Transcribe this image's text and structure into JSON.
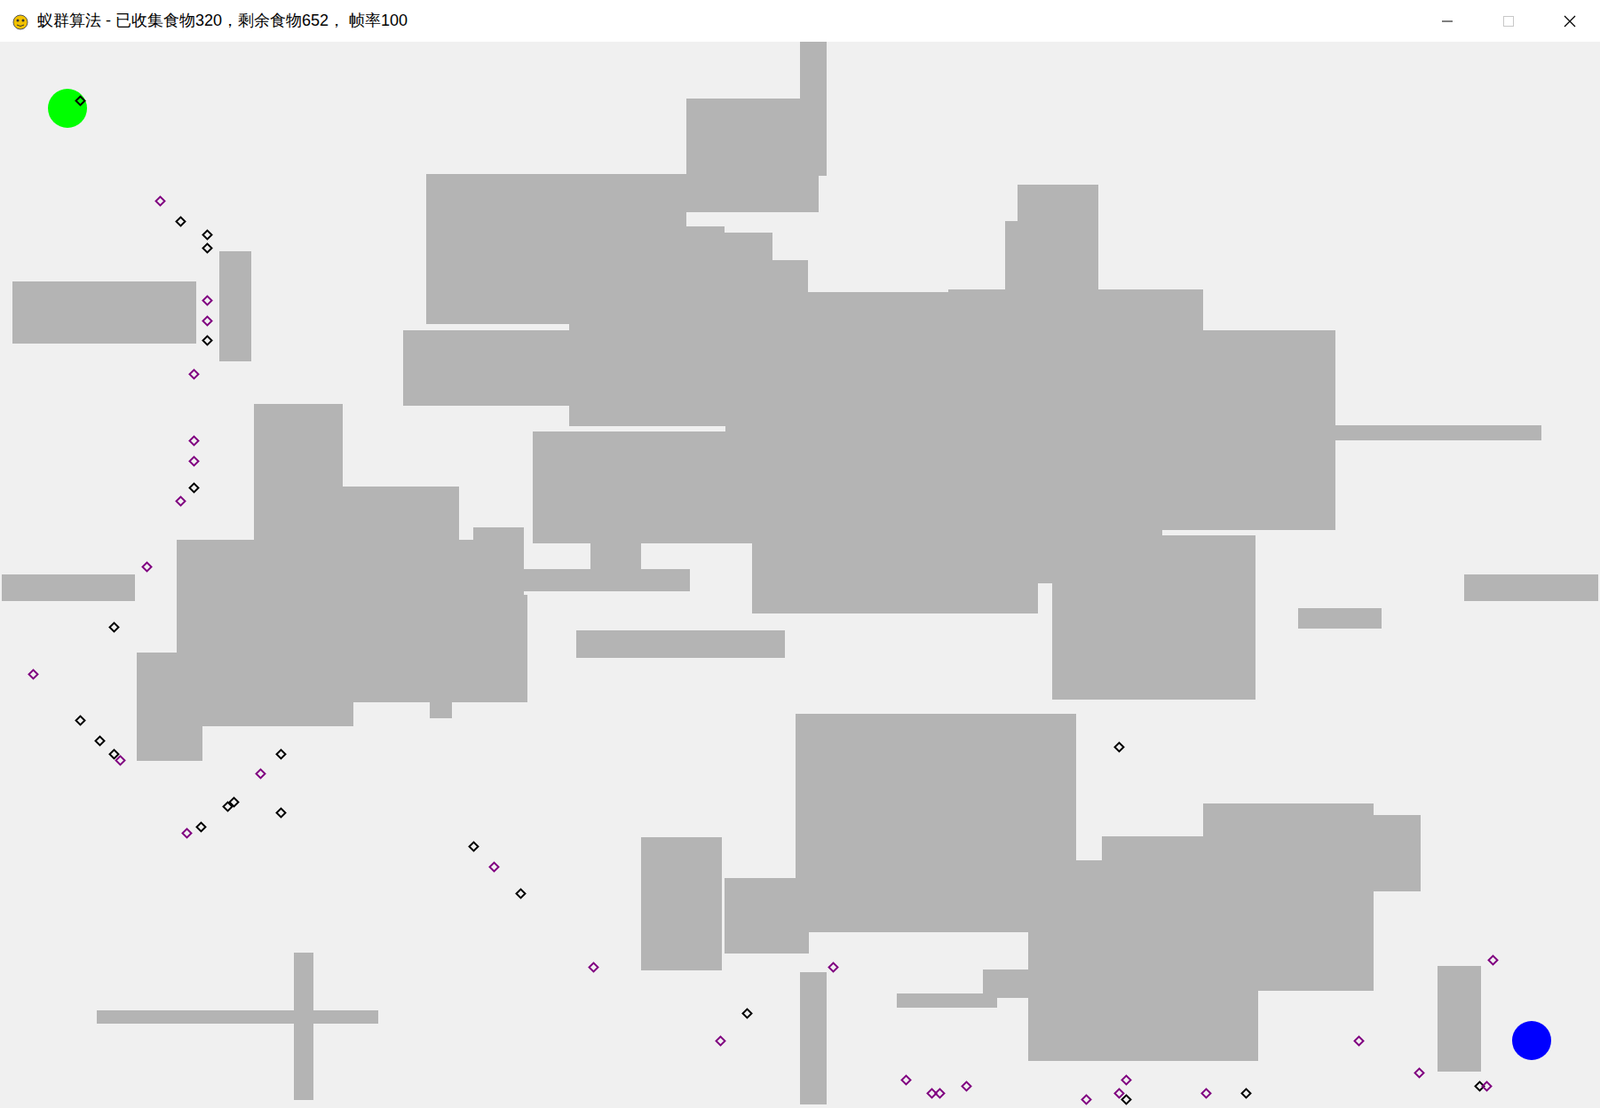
{
  "window": {
    "title": "蚁群算法 - 已收集食物320，剩余食物652， 帧率100",
    "controls": [
      {
        "kind": "minimize",
        "disabled": false
      },
      {
        "kind": "maximize",
        "disabled": true
      },
      {
        "kind": "close",
        "disabled": false
      }
    ]
  },
  "map": {
    "nest": {
      "color": "#00ff00"
    },
    "food_source": {
      "color": "#0000ff"
    },
    "ants": [
      {
        "color": "#000000"
      },
      {
        "color": "#800080"
      },
      {
        "color": "#000000"
      },
      {
        "color": "#000000"
      },
      {
        "color": "#000000"
      },
      {
        "color": "#800080"
      },
      {
        "color": "#800080"
      },
      {
        "color": "#000000"
      },
      {
        "color": "#800080"
      },
      {
        "color": "#800080"
      },
      {
        "color": "#800080"
      },
      {
        "color": "#000000"
      },
      {
        "color": "#800080"
      },
      {
        "color": "#800080"
      },
      {
        "color": "#000000"
      },
      {
        "color": "#800080"
      },
      {
        "color": "#000000"
      },
      {
        "color": "#000000"
      },
      {
        "color": "#000000"
      },
      {
        "color": "#800080"
      },
      {
        "color": "#000000"
      },
      {
        "color": "#800080"
      },
      {
        "color": "#000000"
      },
      {
        "color": "#000000"
      },
      {
        "color": "#000000"
      },
      {
        "color": "#800080"
      },
      {
        "color": "#000000"
      },
      {
        "color": "#000000"
      },
      {
        "color": "#800080"
      },
      {
        "color": "#000000"
      },
      {
        "color": "#800080"
      },
      {
        "color": "#800080"
      },
      {
        "color": "#000000"
      },
      {
        "color": "#800080"
      },
      {
        "color": "#000000"
      },
      {
        "color": "#800080"
      },
      {
        "color": "#800080"
      },
      {
        "color": "#800080"
      },
      {
        "color": "#800080"
      },
      {
        "color": "#800080"
      },
      {
        "color": "#800080"
      },
      {
        "color": "#800080"
      },
      {
        "color": "#000000"
      },
      {
        "color": "#800080"
      },
      {
        "color": "#000000"
      },
      {
        "color": "#800080"
      },
      {
        "color": "#800080"
      },
      {
        "color": "#800080"
      },
      {
        "color": "#000000"
      },
      {
        "color": "#800080"
      }
    ]
  }
}
